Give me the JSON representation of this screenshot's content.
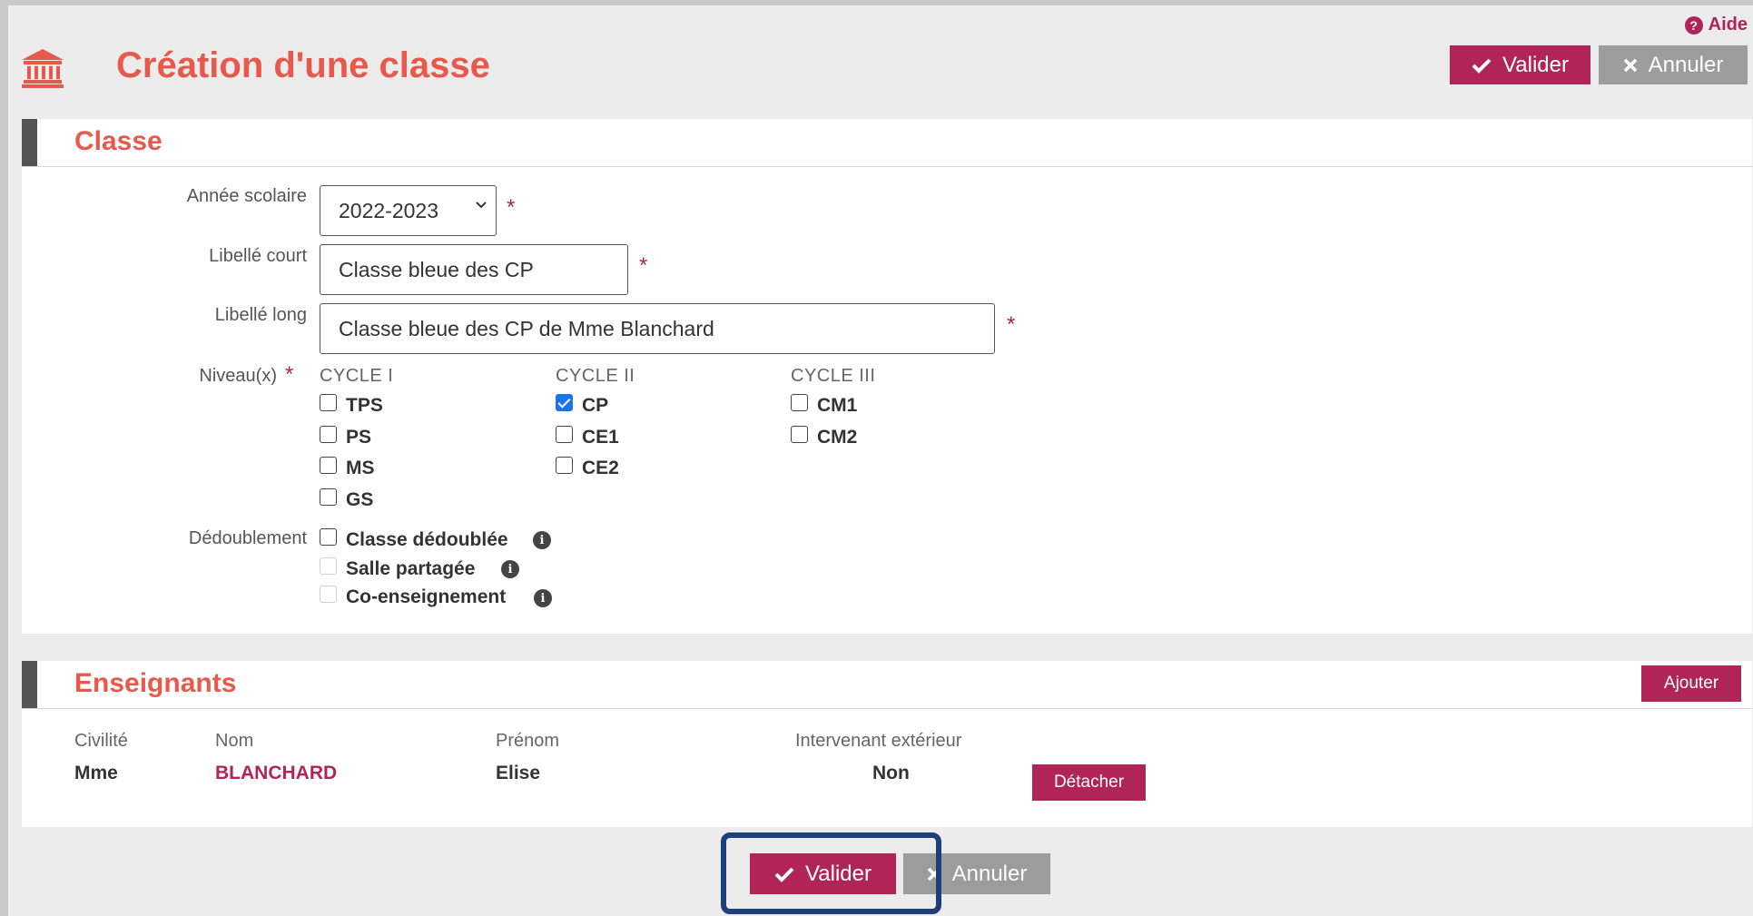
{
  "help": {
    "label": "Aide"
  },
  "page": {
    "title": "Création d'une classe"
  },
  "actions": {
    "valider": "Valider",
    "annuler": "Annuler"
  },
  "classe": {
    "section_title": "Classe",
    "annee": {
      "label": "Année scolaire",
      "value": "2022-2023"
    },
    "libelle_court": {
      "label": "Libellé court",
      "value": "Classe bleue des CP"
    },
    "libelle_long": {
      "label": "Libellé long",
      "value": "Classe bleue des CP de Mme Blanchard"
    },
    "niveaux": {
      "label": "Niveau(x)",
      "cycles": [
        {
          "name": "CYCLE I",
          "items": [
            {
              "label": "TPS",
              "checked": false
            },
            {
              "label": "PS",
              "checked": false
            },
            {
              "label": "MS",
              "checked": false
            },
            {
              "label": "GS",
              "checked": false
            }
          ]
        },
        {
          "name": "CYCLE II",
          "items": [
            {
              "label": "CP",
              "checked": true
            },
            {
              "label": "CE1",
              "checked": false
            },
            {
              "label": "CE2",
              "checked": false
            }
          ]
        },
        {
          "name": "CYCLE III",
          "items": [
            {
              "label": "CM1",
              "checked": false
            },
            {
              "label": "CM2",
              "checked": false
            }
          ]
        }
      ]
    },
    "dedoublement": {
      "label": "Dédoublement",
      "options": [
        {
          "label": "Classe dédoublée",
          "checked": false,
          "disabled": false
        },
        {
          "label": "Salle partagée",
          "checked": false,
          "disabled": true
        },
        {
          "label": "Co-enseignement",
          "checked": false,
          "disabled": true
        }
      ]
    }
  },
  "enseignants": {
    "section_title": "Enseignants",
    "add_label": "Ajouter",
    "columns": [
      "Civilité",
      "Nom",
      "Prénom",
      "Intervenant extérieur"
    ],
    "rows": [
      {
        "civilite": "Mme",
        "nom": "BLANCHARD",
        "prenom": "Elise",
        "intervenant": "Non",
        "action": "Détacher"
      }
    ]
  },
  "colors": {
    "accent": "#b02556",
    "title": "#e8594d",
    "secondary": "#9c9c9c",
    "focus": "#1f3f7a"
  },
  "icons": [
    "question-icon",
    "institution-icon",
    "check-icon",
    "close-icon",
    "info-icon",
    "chevron-down-icon"
  ]
}
